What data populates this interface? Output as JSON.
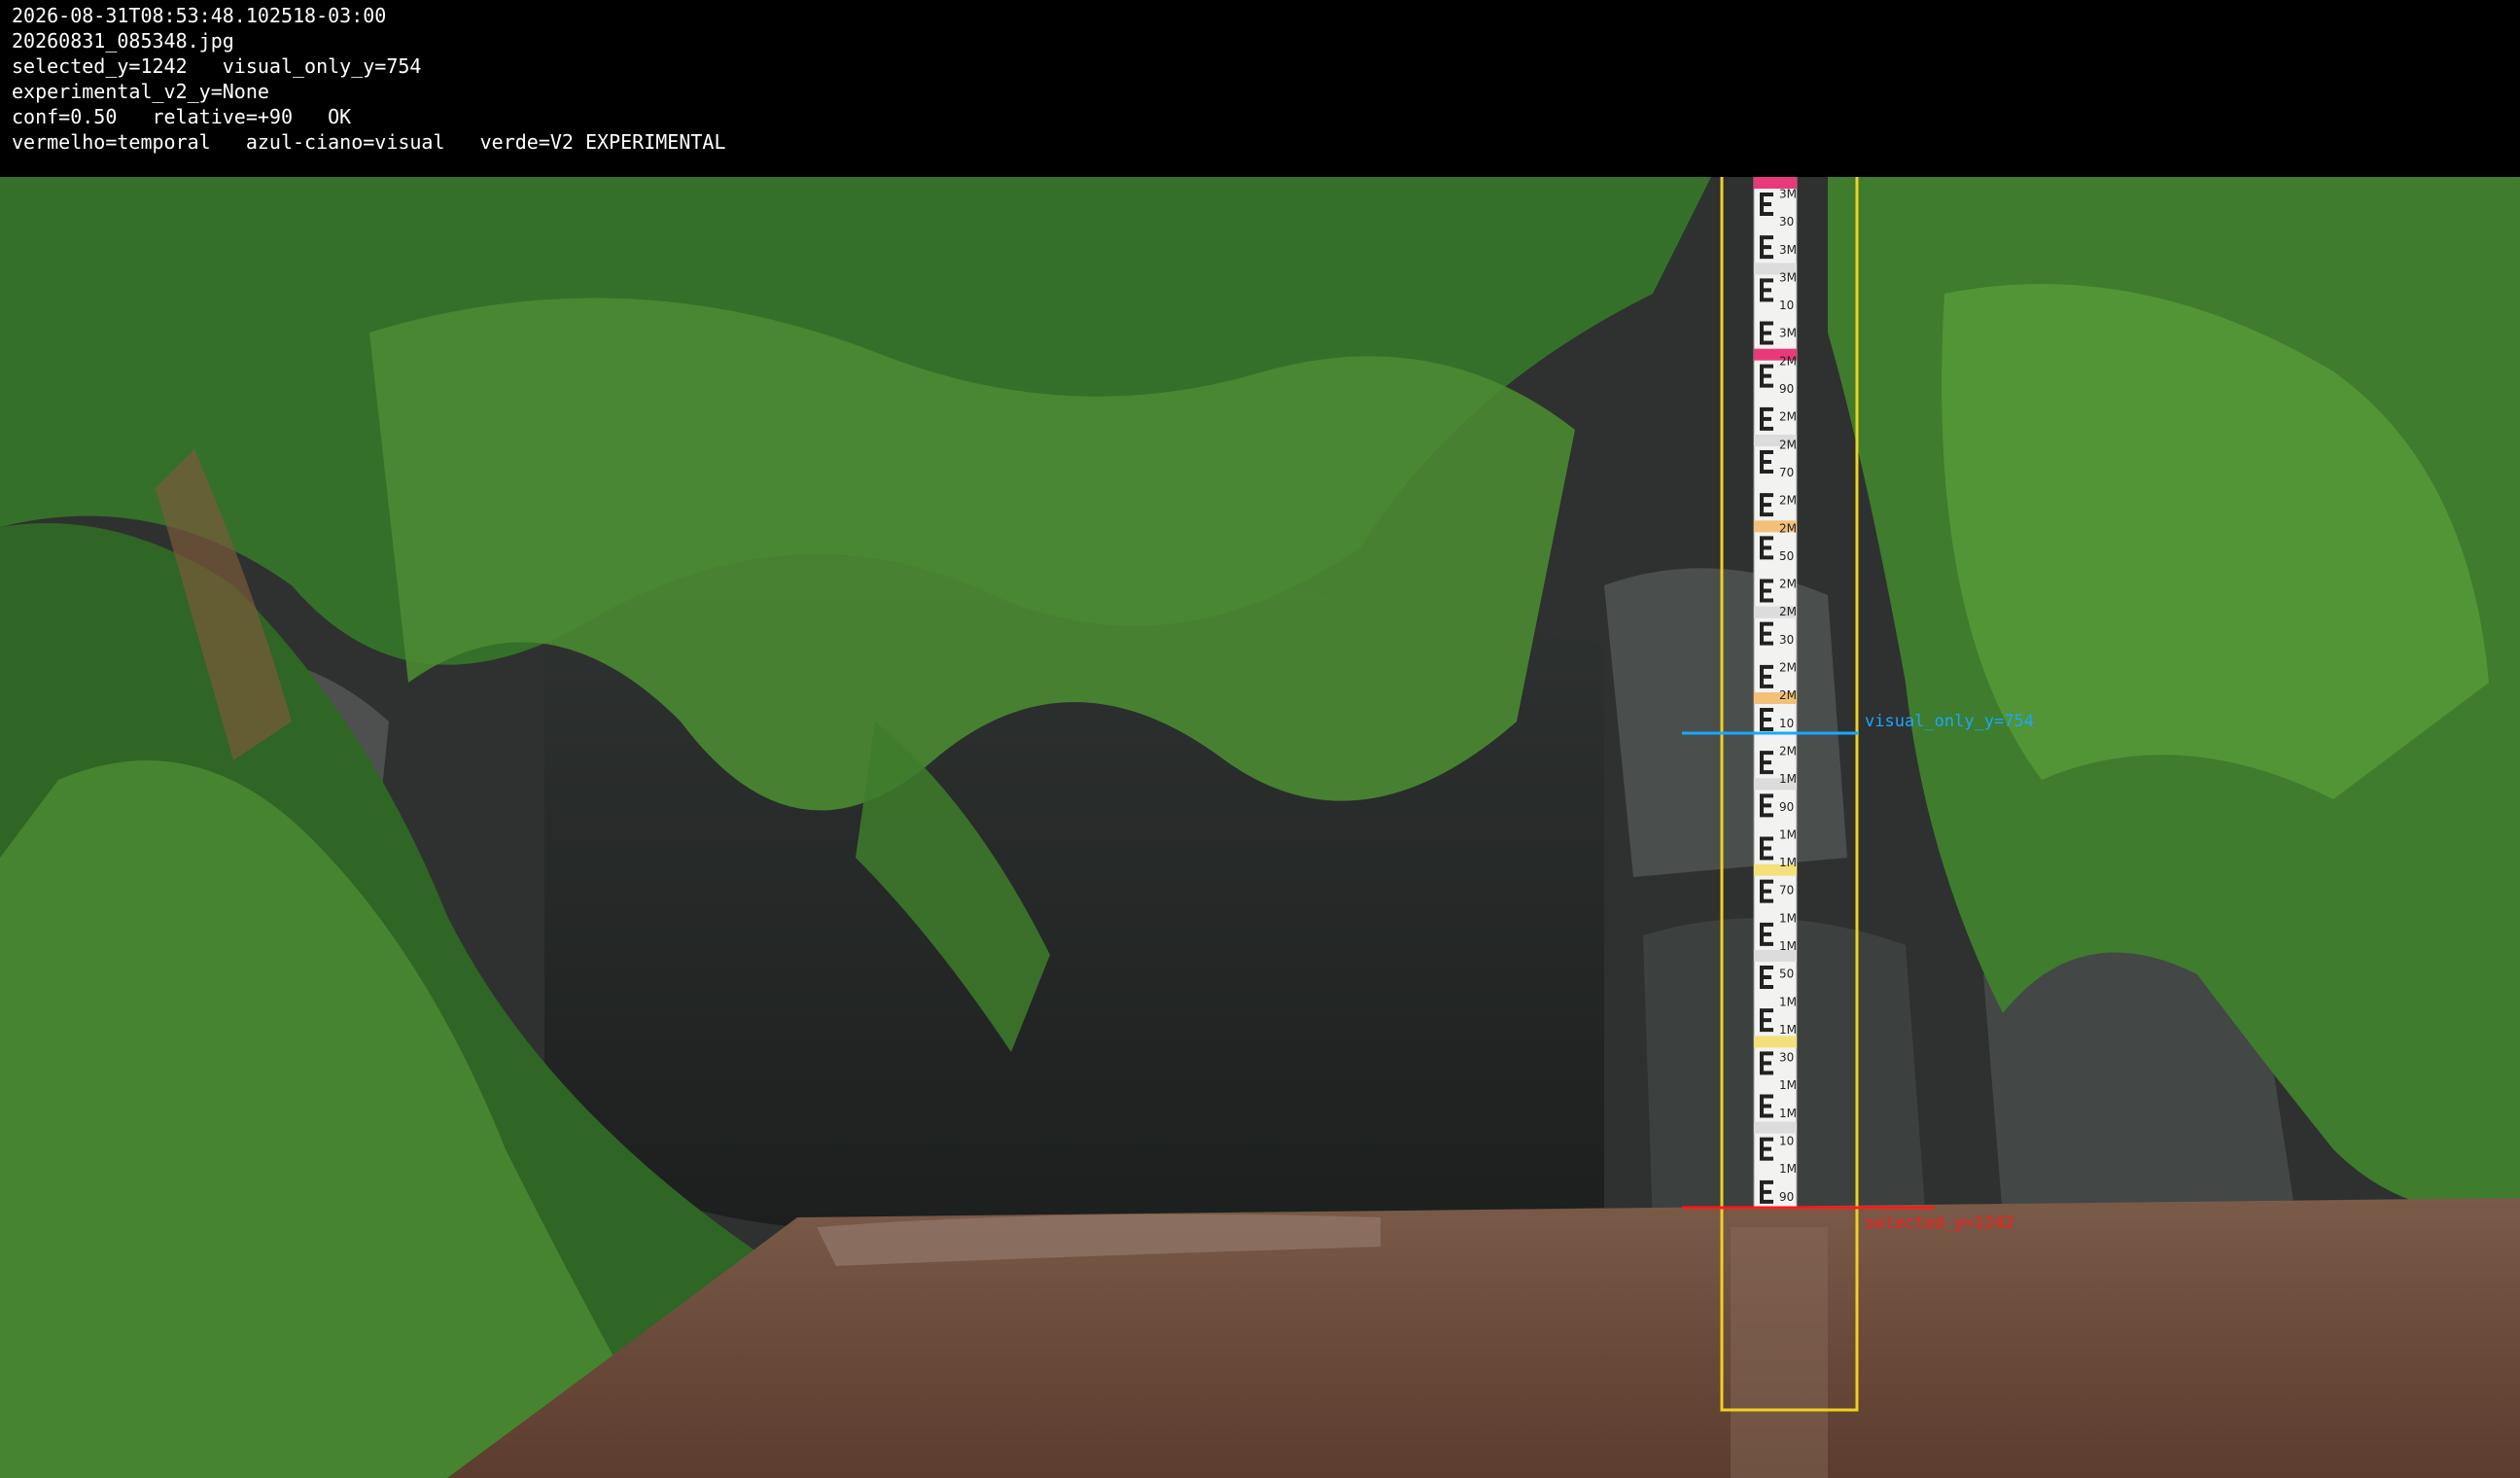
{
  "overlay_text": {
    "timestamp": "2026-08-31T08:53:48.102518-03:00",
    "filename": "20260831_085348.jpg",
    "selected_line": "selected_y=1242   visual_only_y=754",
    "experimental_line": "experimental_v2_y=None",
    "confidence_line": "conf=0.50   relative=+90   OK",
    "legend_line": "vermelho=temporal   azul-ciano=visual   verde=V2 EXPERIMENTAL"
  },
  "markers": {
    "visual_label": "visual_only_y=754",
    "selected_label": "selected_y=1242"
  },
  "gauge_labels": [
    "3M",
    "30",
    "3M",
    "3M",
    "10",
    "3M",
    "2M",
    "90",
    "2M",
    "2M",
    "70",
    "2M",
    "2M",
    "50",
    "2M",
    "2M",
    "30",
    "2M",
    "2M",
    "10",
    "2M",
    "1M",
    "90",
    "1M",
    "1M",
    "70",
    "1M",
    "1M",
    "50",
    "1M",
    "1M",
    "30",
    "1M",
    "1M",
    "10",
    "1M",
    "90"
  ],
  "colors": {
    "roi_box": "#f0d020",
    "visual_line": "#1aa8ff",
    "selected_line": "#ff1a1a",
    "water": "#6a4a3a",
    "rock": "#3a3d3c",
    "foliage": "#3f7a2a"
  }
}
